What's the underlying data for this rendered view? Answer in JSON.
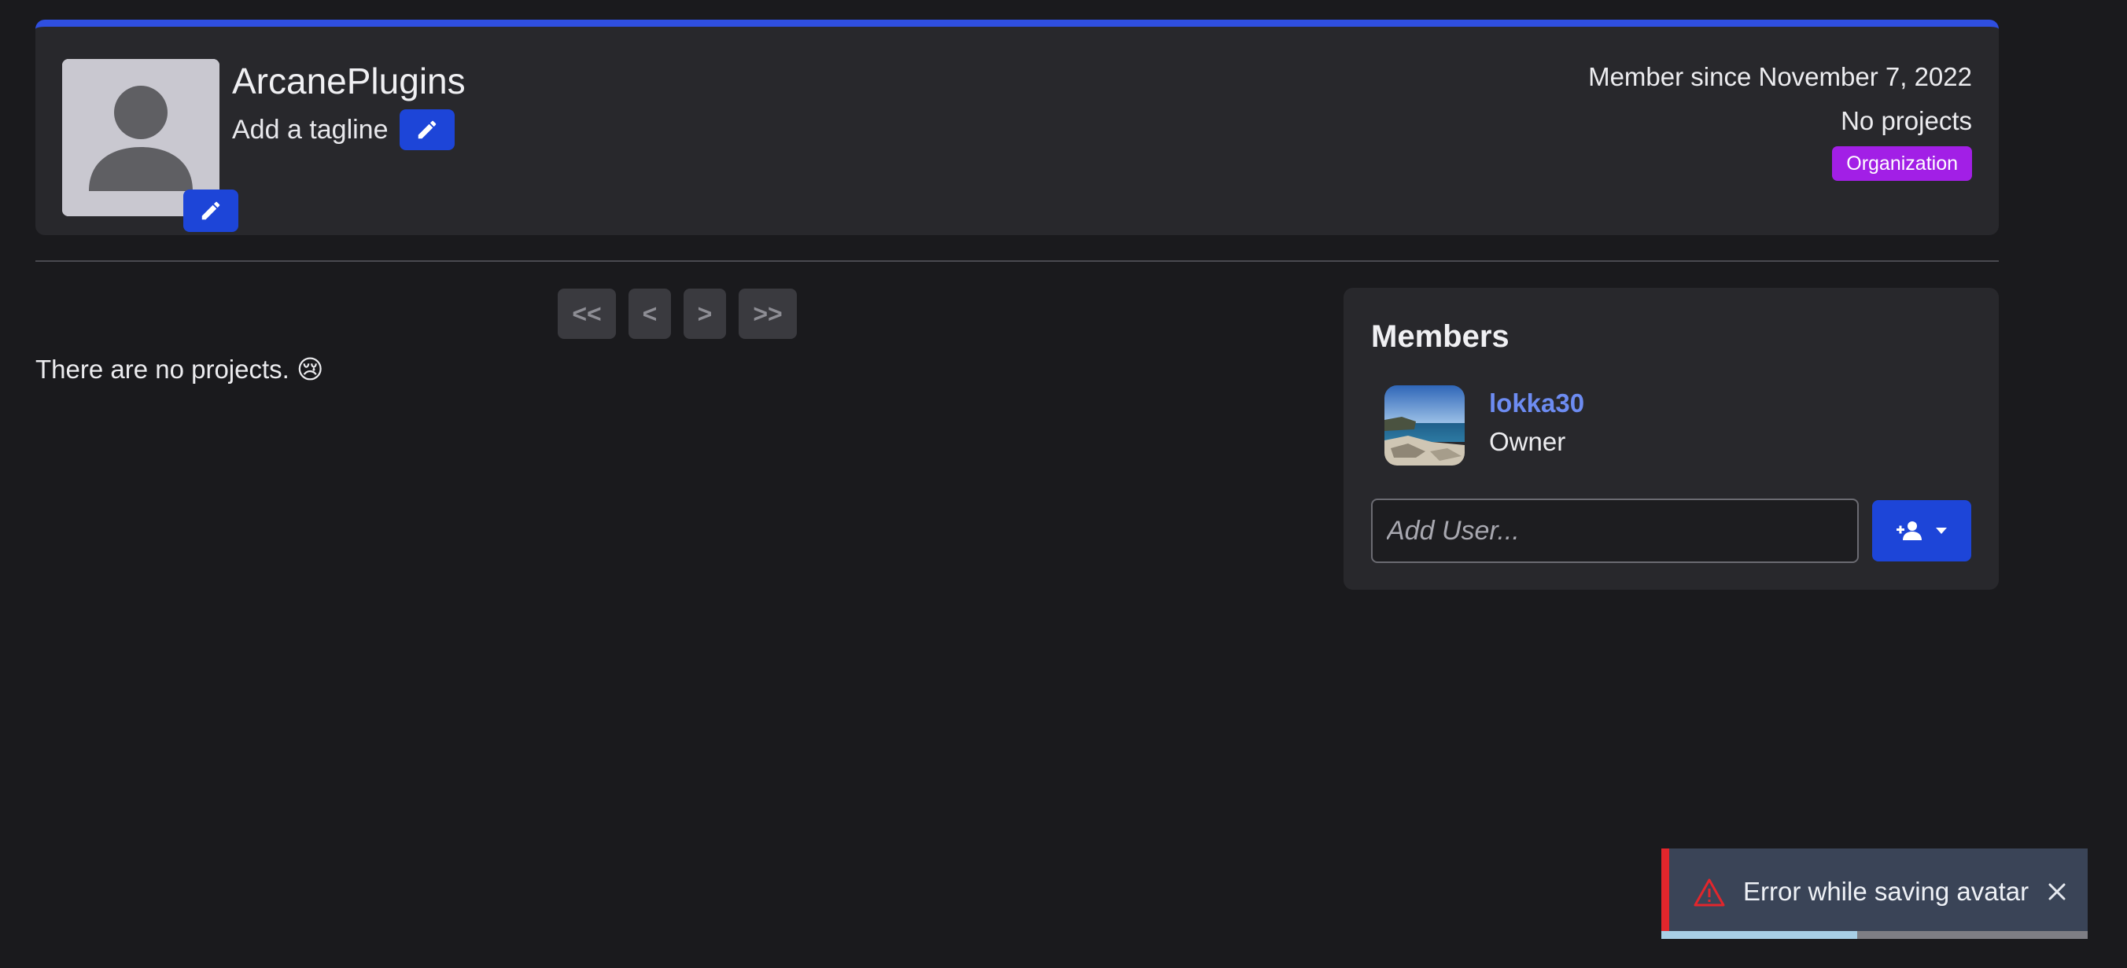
{
  "header": {
    "org_name": "ArcanePlugins",
    "tagline": "Add a tagline",
    "member_since": "Member since November 7, 2022",
    "project_count": "No projects",
    "badge": "Organization",
    "accent_color": "#2f4fe0",
    "badge_color": "#a21fe6",
    "icons": [
      "avatar-placeholder-icon",
      "pencil-icon"
    ]
  },
  "pagination": {
    "first": "<<",
    "prev": "<",
    "next": ">",
    "last": ">>"
  },
  "projects": {
    "empty_message": "There are no projects. 😢"
  },
  "members": {
    "title": "Members",
    "list": [
      {
        "name": "lokka30",
        "role": "Owner"
      }
    ],
    "add_user_placeholder": "Add User...",
    "add_user_icons": [
      "person-add-icon",
      "caret-down-icon"
    ]
  },
  "toast": {
    "message": "Error while saving avatar",
    "type": "error",
    "progress": 0.46,
    "icons": [
      "warning-icon",
      "close-icon"
    ]
  }
}
